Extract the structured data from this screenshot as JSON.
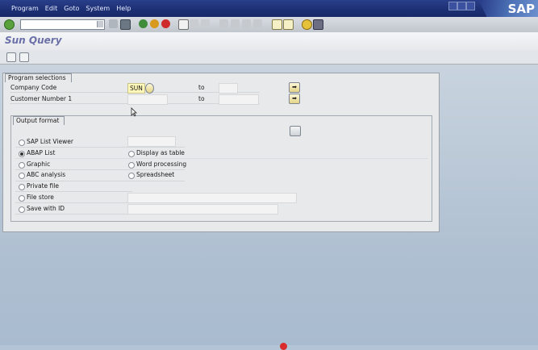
{
  "menu": [
    "Program",
    "Edit",
    "Goto",
    "System",
    "Help"
  ],
  "brand": "SAP",
  "title": "Sun Query",
  "program_selections": {
    "label": "Program selections",
    "company_code_label": "Company Code",
    "company_code_value": "SUN",
    "to_label": "to",
    "customer_number_label": "Customer Number 1",
    "to_label_2": "to"
  },
  "output_format": {
    "label": "Output format",
    "left_options": [
      "SAP List Viewer",
      "ABAP List",
      "Graphic",
      "ABC analysis",
      "Private file",
      "File store",
      "Save with ID"
    ],
    "right_options": [
      "Display as table",
      "Word processing",
      "Spreadsheet"
    ]
  },
  "colors": {
    "menubar": "#1d2f73",
    "required_field": "#fff8b8",
    "workspace": "#b3c4d6"
  },
  "icons": {
    "enter": "check-icon",
    "save": "save-icon",
    "back": "back-icon",
    "exit": "exit-icon",
    "cancel": "cancel-icon",
    "print": "printer-icon",
    "execute": "execute-icon",
    "multiple_selection": "arrow-right-icon"
  }
}
